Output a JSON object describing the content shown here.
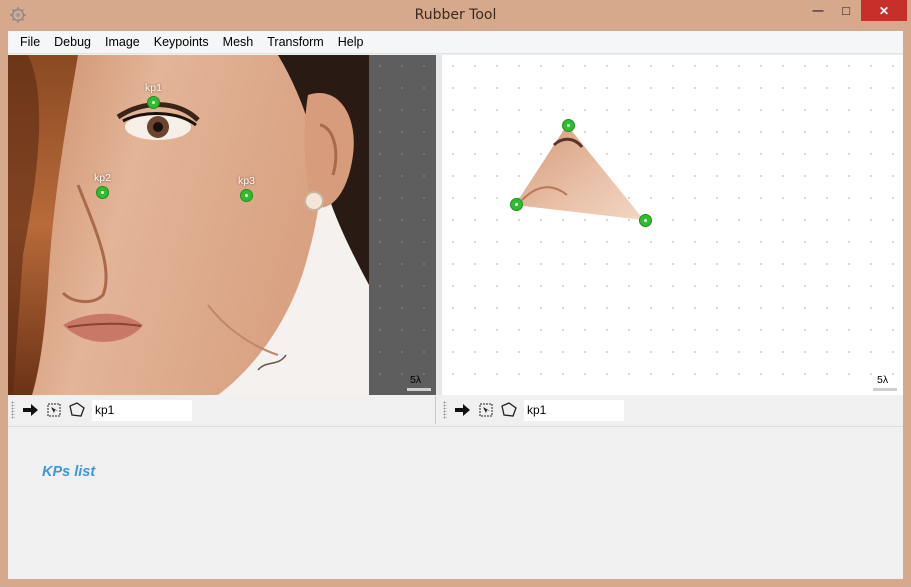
{
  "window": {
    "title": "Rubber Tool",
    "min_glyph": "—",
    "max_glyph": "□",
    "close_glyph": "✕"
  },
  "menu": [
    "File",
    "Debug",
    "Image",
    "Keypoints",
    "Mesh",
    "Transform",
    "Help"
  ],
  "left_view": {
    "keypoints": [
      "kp1",
      "kp2",
      "kp3"
    ],
    "scale_label": "5λ"
  },
  "right_view": {
    "scale_label": "5λ"
  },
  "toolbar_left": {
    "kp_value": "kp1"
  },
  "toolbar_right": {
    "kp_value": "kp1"
  },
  "kps_list": {
    "title": "KPs list"
  },
  "colors": {
    "keypoint": "#2ebd2e",
    "kps_title": "#3d97df",
    "frame": "#d7a98c"
  }
}
